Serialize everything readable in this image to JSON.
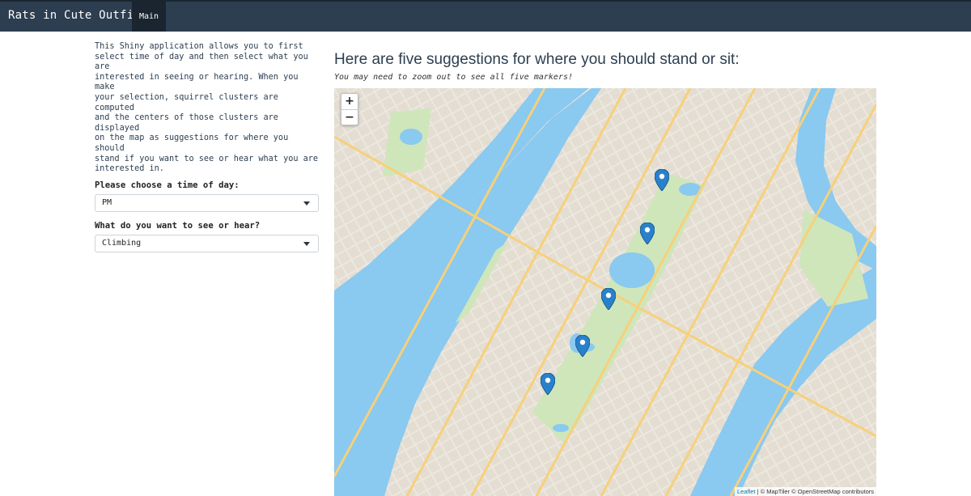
{
  "navbar": {
    "brand": "Rats in Cute Outfits",
    "tabs": [
      {
        "label": "Main",
        "active": true
      }
    ]
  },
  "sidebar": {
    "intro": "This Shiny application allows you to first\nselect time of day and then select what you are\ninterested in seeing or hearing. When you make\nyour selection, squirrel clusters are computed\nand the centers of those clusters are displayed\non the map as suggestions for where you should\nstand if you want to see or hear what you are\ninterested in.",
    "time_label": "Please choose a time of day:",
    "time_value": "PM",
    "activity_label": "What do you want to see or hear?",
    "activity_value": "Climbing"
  },
  "main": {
    "title": "Here are five suggestions for where you should stand or sit:",
    "note": "You may need to zoom out to see all five markers!"
  },
  "map": {
    "zoom_in": "+",
    "zoom_out": "−",
    "attribution_leaflet": "Leaflet",
    "attribution_rest": " | © MapTiler © OpenStreetMap contributors",
    "marker_count": 5,
    "colors": {
      "water": "#8ac9f0",
      "park": "#cfe6bb",
      "land": "#ede8df",
      "road": "#f7d07a",
      "marker": "#2a81cb"
    }
  }
}
